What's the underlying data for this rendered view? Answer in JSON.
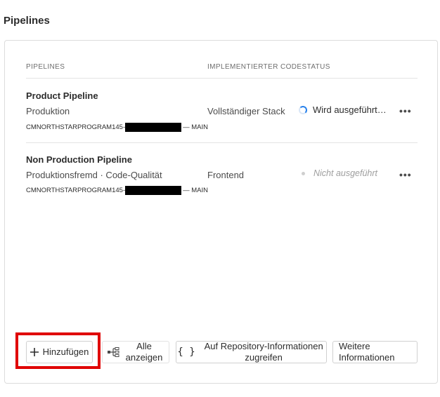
{
  "section": {
    "title": "Pipelines"
  },
  "table": {
    "col_pipelines": "PIPELINES",
    "col_code_status": "IMPLEMENTIERTER CODESTATUS",
    "rows": [
      {
        "name": "Product Pipeline",
        "subtitle": "Produktion",
        "repo_prefix": "CMNORTHSTARPROGRAM145-",
        "repo_suffix": "— MAIN",
        "code_status": "Vollständiger Stack",
        "run_status": "Wird ausgeführt…",
        "run_state": "running",
        "more_label": "•••"
      },
      {
        "name": "Non Production Pipeline",
        "subtitle": "Produktionsfremd · Code-Qualität",
        "repo_prefix": "CMNORTHSTARPROGRAM145-",
        "repo_suffix": "— MAIN",
        "code_status": "Frontend",
        "run_status": "Nicht ausgeführt",
        "run_state": "idle",
        "more_label": "•••"
      }
    ]
  },
  "actions": {
    "add": "Hinzufügen",
    "show_all": "Alle anzeigen",
    "repo_info": "Auf Repository-Informationen zugreifen",
    "more_info": "Weitere Informationen"
  },
  "colors": {
    "highlight": "#e00000",
    "spinner": "#2680eb"
  }
}
